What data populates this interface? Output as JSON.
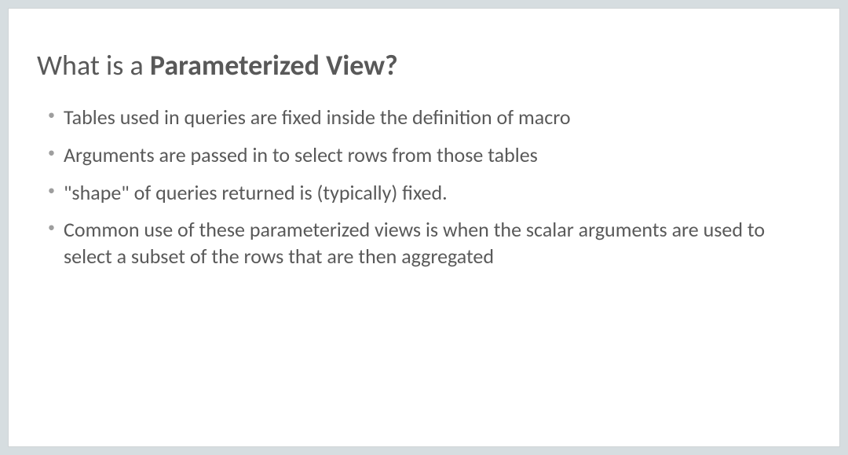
{
  "title_prefix": "What is a ",
  "title_bold": "Parameterized View?",
  "bullets": [
    "Tables used in queries are fixed inside the definition of macro",
    "Arguments are passed in to select rows from those tables",
    "\"shape\" of queries returned is (typically) fixed.",
    "Common use of these parameterized views is when the scalar arguments are used to select a subset of the rows that are then aggregated"
  ]
}
